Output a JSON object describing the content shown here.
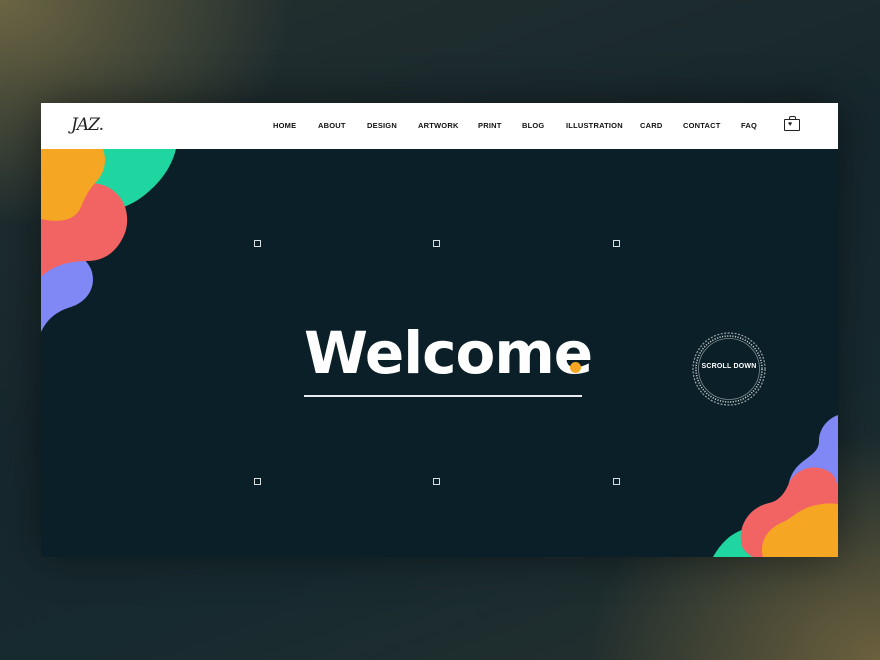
{
  "brand": {
    "logo_text": "JAZ."
  },
  "nav": {
    "items": [
      {
        "id": "home",
        "label": "HOME"
      },
      {
        "id": "about",
        "label": "ABOUT"
      },
      {
        "id": "design",
        "label": "DESIGN"
      },
      {
        "id": "artwork",
        "label": "ARTWORK"
      },
      {
        "id": "print",
        "label": "PRINT"
      },
      {
        "id": "blog",
        "label": "BLOG"
      },
      {
        "id": "illustration",
        "label": "ILLUSTRATION"
      },
      {
        "id": "card",
        "label": "CARD"
      },
      {
        "id": "contact",
        "label": "CONTACT"
      },
      {
        "id": "faq",
        "label": "FAQ"
      }
    ],
    "cart_icon": "shopping-bag-heart-icon"
  },
  "hero": {
    "headline": "Welcome",
    "scroll_label": "SCROLL DOWN"
  },
  "colors": {
    "hero_background": "#0b1f28",
    "accent_orange": "#f5a623",
    "blob_green": "#1fd6a0",
    "blob_coral": "#f26464",
    "blob_periwinkle": "#8088f5"
  }
}
